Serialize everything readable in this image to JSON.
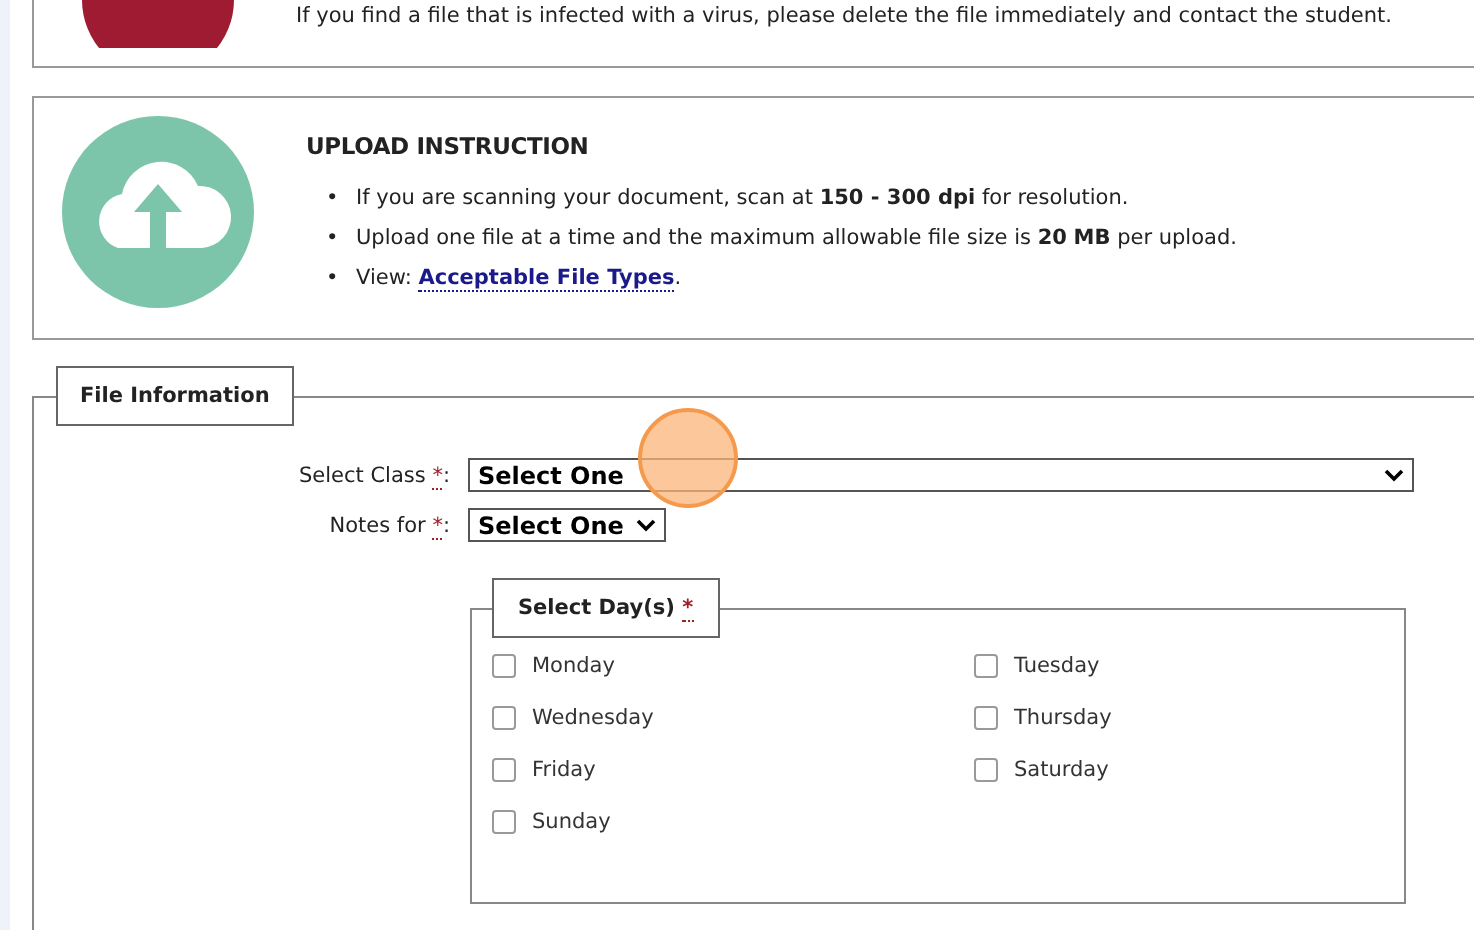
{
  "virus_notice": {
    "text": "If you find a file that is infected with a virus, please delete the file immediately and contact the student."
  },
  "upload_instruction": {
    "title": "UPLOAD INSTRUCTION",
    "items": [
      {
        "kind": "text",
        "bullet": "•",
        "text": "If you are scanning your document, scan at **150 - 300 dpi** for resolution."
      },
      {
        "kind": "text",
        "bullet": "•",
        "text": "Upload one file at a time and the maximum allowable file size is **20** **MB** per upload."
      },
      {
        "kind": "link",
        "bullet": "•",
        "text": "View: ",
        "link": "Acceptable File Types",
        "after": "."
      }
    ]
  },
  "file_information": {
    "legend": "File Information",
    "fields": [
      {
        "label": "Select Class ",
        "required": "*",
        "colon": ":",
        "value": "Select One",
        "wide": true
      },
      {
        "label": "Notes for ",
        "required": "*",
        "colon": ":",
        "value": "Select One",
        "wide": false
      }
    ],
    "days": {
      "legend": "Select Day(s) ",
      "required": "*",
      "items": [
        {
          "label": "Monday",
          "checked": false
        },
        {
          "label": "Tuesday",
          "checked": false
        },
        {
          "label": "Wednesday",
          "checked": false
        },
        {
          "label": "Thursday",
          "checked": false
        },
        {
          "label": "Friday",
          "checked": false
        },
        {
          "label": "Saturday",
          "checked": false
        },
        {
          "label": "Sunday",
          "checked": false
        }
      ]
    }
  }
}
